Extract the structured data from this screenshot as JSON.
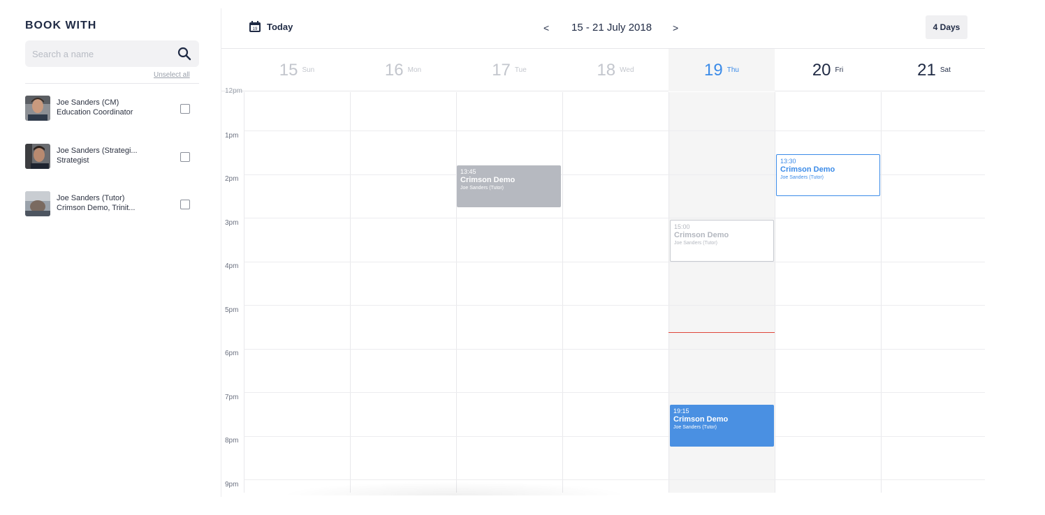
{
  "sidebar": {
    "title": "BOOK WITH",
    "search_placeholder": "Search a name",
    "unselect_all": "Unselect all",
    "people": [
      {
        "name": "Joe Sanders (CM)",
        "role": "Education Coordinator"
      },
      {
        "name": "Joe Sanders (Strategi...",
        "role": "Strategist"
      },
      {
        "name": "Joe Sanders (Tutor)",
        "role": "Crimson Demo, Trinit..."
      }
    ]
  },
  "toolbar": {
    "today_label": "Today",
    "today_icon_number": "19",
    "prev": "<",
    "range": "15 - 21 July 2018",
    "next": ">",
    "view_label": "4 Days"
  },
  "days": [
    {
      "num": "15",
      "name": "Sun"
    },
    {
      "num": "16",
      "name": "Mon"
    },
    {
      "num": "17",
      "name": "Tue"
    },
    {
      "num": "18",
      "name": "Wed"
    },
    {
      "num": "19",
      "name": "Thu"
    },
    {
      "num": "20",
      "name": "Fri"
    },
    {
      "num": "21",
      "name": "Sat"
    }
  ],
  "time_labels": [
    "12pm",
    "1pm",
    "2pm",
    "3pm",
    "4pm",
    "5pm",
    "6pm",
    "7pm",
    "8pm",
    "9pm"
  ],
  "events": [
    {
      "time": "13:45",
      "title": "Crimson Demo",
      "person": "Joe Sanders (Tutor)",
      "day": "17 Tue",
      "style": "past-booked"
    },
    {
      "time": "13:30",
      "title": "Crimson Demo",
      "person": "Joe Sanders (Tutor)",
      "day": "20 Fri",
      "style": "upcoming-outline"
    },
    {
      "time": "15:00",
      "title": "Crimson Demo",
      "person": "Joe Sanders (Tutor)",
      "day": "19 Thu",
      "style": "past-outline"
    },
    {
      "time": "19:15",
      "title": "Crimson Demo",
      "person": "Joe Sanders (Tutor)",
      "day": "19 Thu",
      "style": "upcoming-booked"
    }
  ],
  "colors": {
    "accent": "#3b8be8",
    "event_blue": "#4a90e2",
    "event_gray": "#b6b9c0",
    "now_line": "#e0453a",
    "today_column": "#f5f5f5"
  }
}
